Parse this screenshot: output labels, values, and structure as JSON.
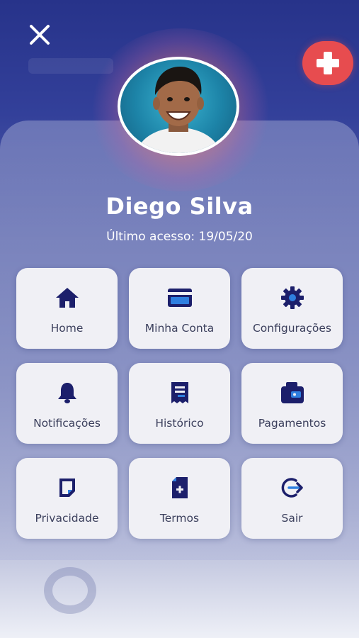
{
  "header": {
    "close_icon": "close-icon",
    "plus_icon": "plus-icon",
    "accent_color": "#e74c4f"
  },
  "profile": {
    "name": "Diego Silva",
    "last_access": "Último acesso: 19/05/20"
  },
  "menu": {
    "icon_color": "#1c1f6b",
    "items": [
      {
        "label": "Home",
        "icon": "home-icon"
      },
      {
        "label": "Minha Conta",
        "icon": "card-icon"
      },
      {
        "label": "Configurações",
        "icon": "gear-icon"
      },
      {
        "label": "Notificações",
        "icon": "bell-icon"
      },
      {
        "label": "Histórico",
        "icon": "receipt-icon"
      },
      {
        "label": "Pagamentos",
        "icon": "wallet-icon"
      },
      {
        "label": "Privacidade",
        "icon": "note-icon"
      },
      {
        "label": "Termos",
        "icon": "document-plus-icon"
      },
      {
        "label": "Sair",
        "icon": "logout-icon"
      }
    ]
  }
}
